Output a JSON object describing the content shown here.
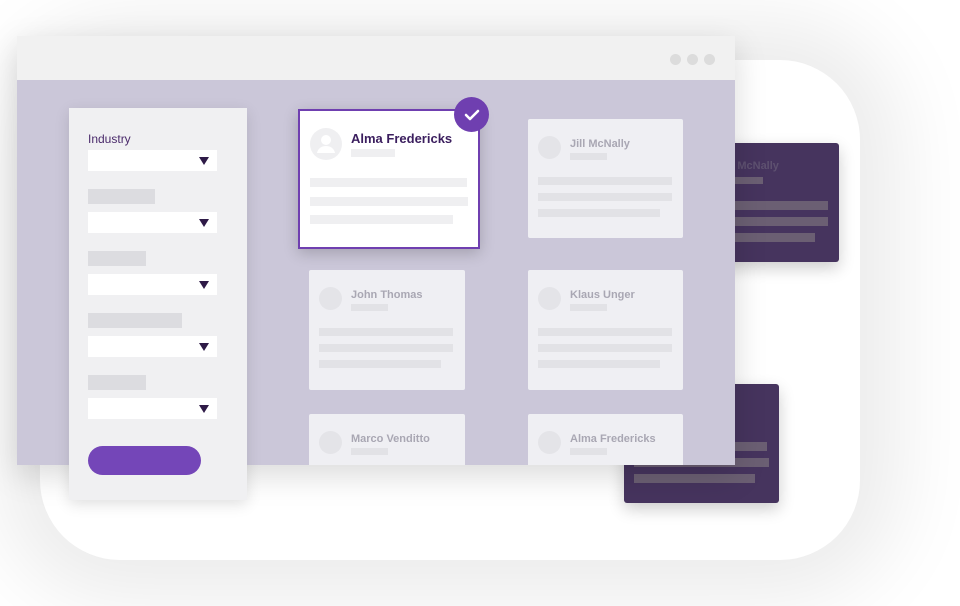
{
  "filters": {
    "industry_label": "Industry",
    "selects": 5
  },
  "cards": [
    {
      "name": "Alma Fredericks",
      "selected": true
    },
    {
      "name": "Jill McNally"
    },
    {
      "name": "John Thomas"
    },
    {
      "name": "Klaus Unger"
    },
    {
      "name": "Marco Venditto"
    },
    {
      "name": "Alma Fredericks"
    }
  ],
  "background_cards": [
    {
      "name": "Jill McNally"
    }
  ],
  "colors": {
    "accent": "#6f3fb0",
    "window_bg": "#cbc7d9",
    "dark_card": "#46345e"
  },
  "icons": {
    "selected": "check-icon",
    "avatar": "user-icon",
    "dropdown": "triangle-down-icon"
  }
}
